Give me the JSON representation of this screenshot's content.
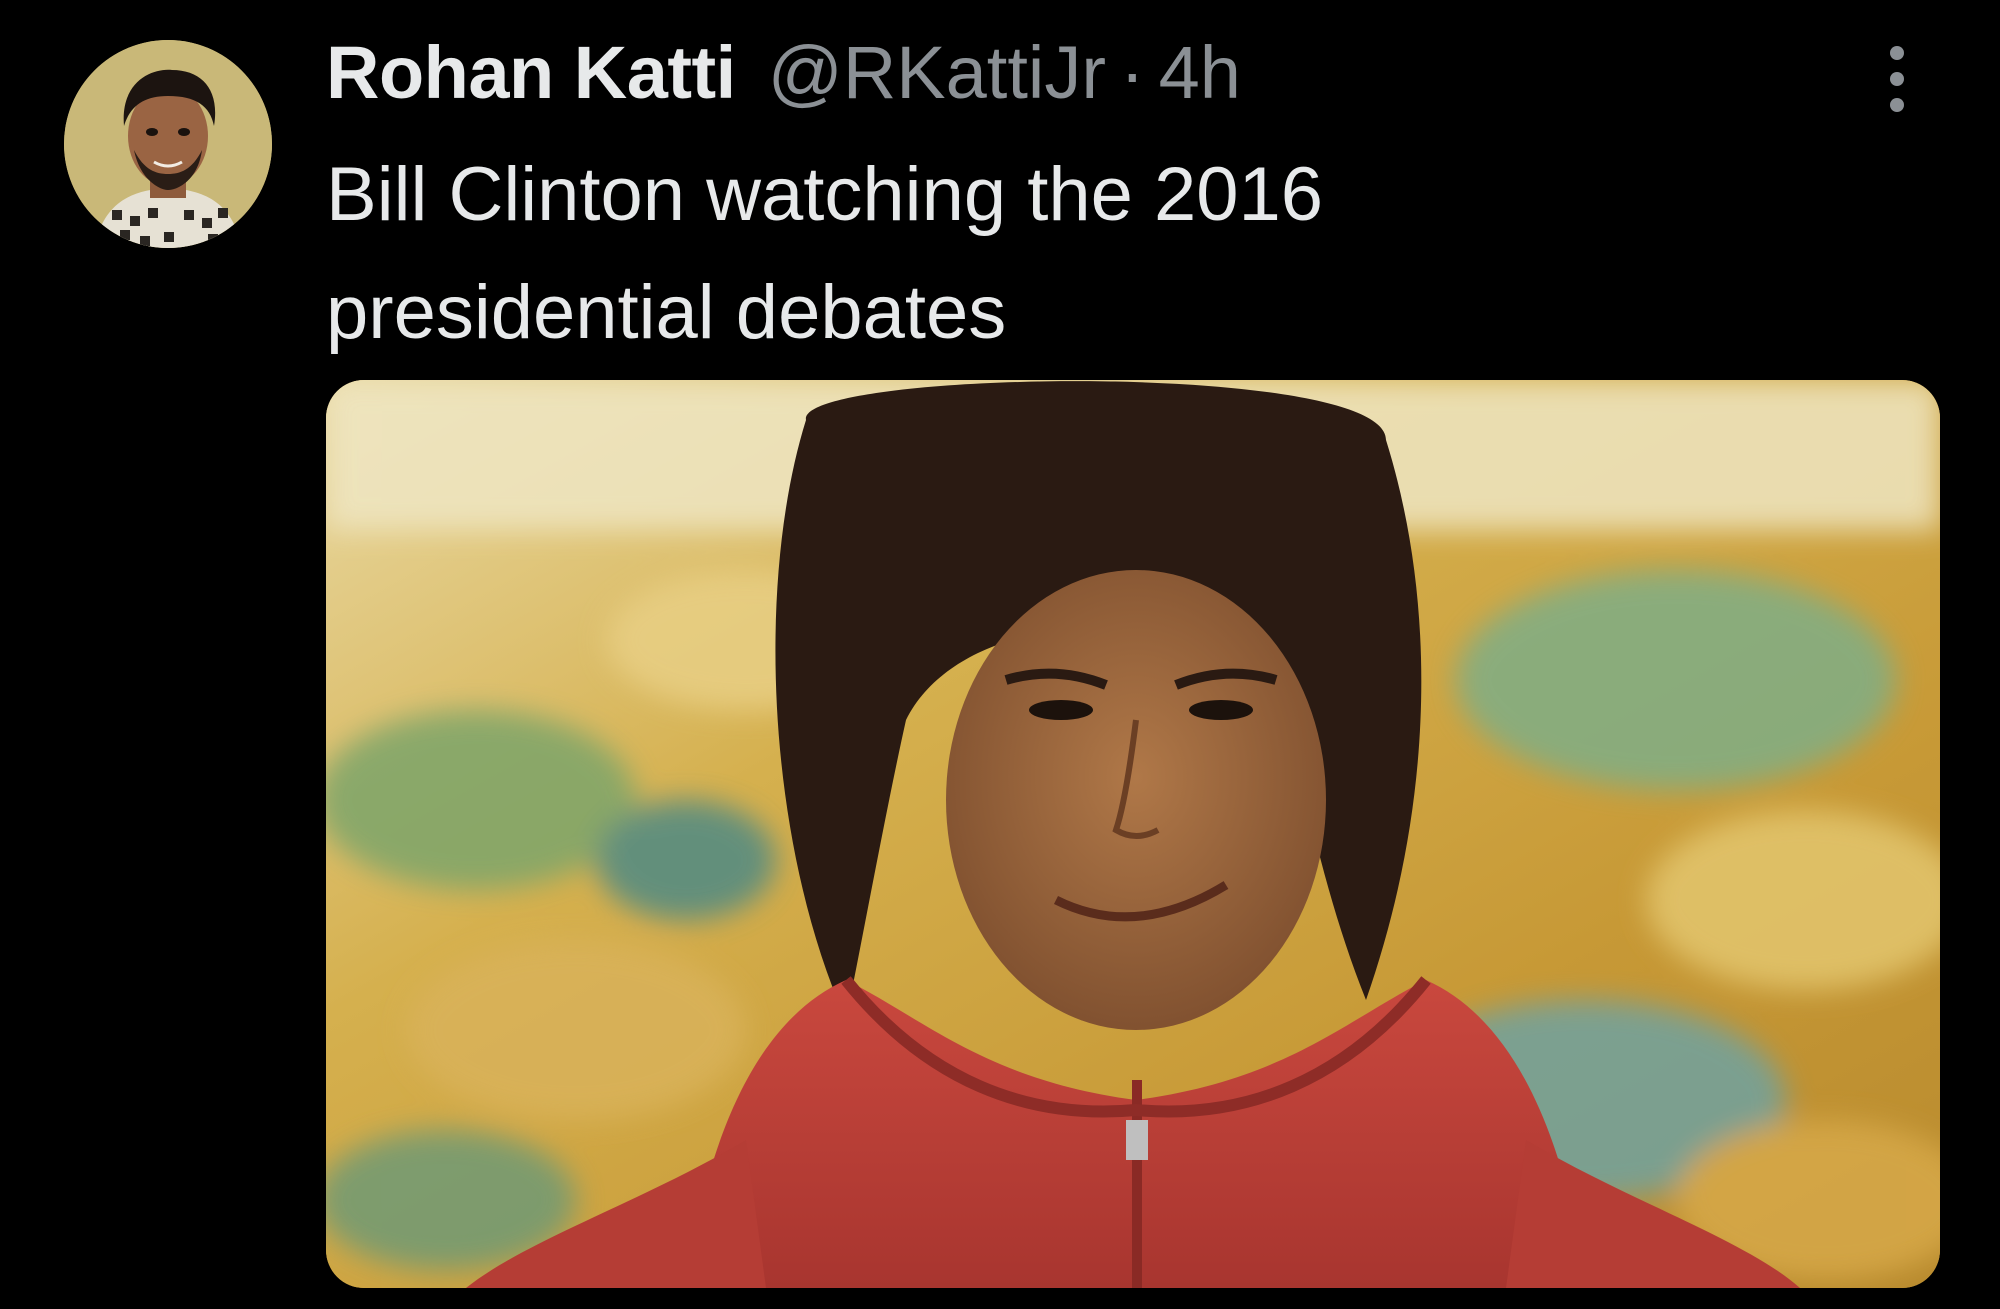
{
  "tweet": {
    "author": {
      "display_name": "Rohan Katti",
      "handle": "@RKattiJr",
      "separator": "·",
      "time": "4h"
    },
    "text_line1": "Bill Clinton watching the 2016",
    "text_line2": "presidential debates",
    "more_icon": "more-vertical-icon"
  },
  "colors": {
    "background": "#000000",
    "primary_text": "#e7e9ea",
    "secondary_text": "#8b9095"
  }
}
